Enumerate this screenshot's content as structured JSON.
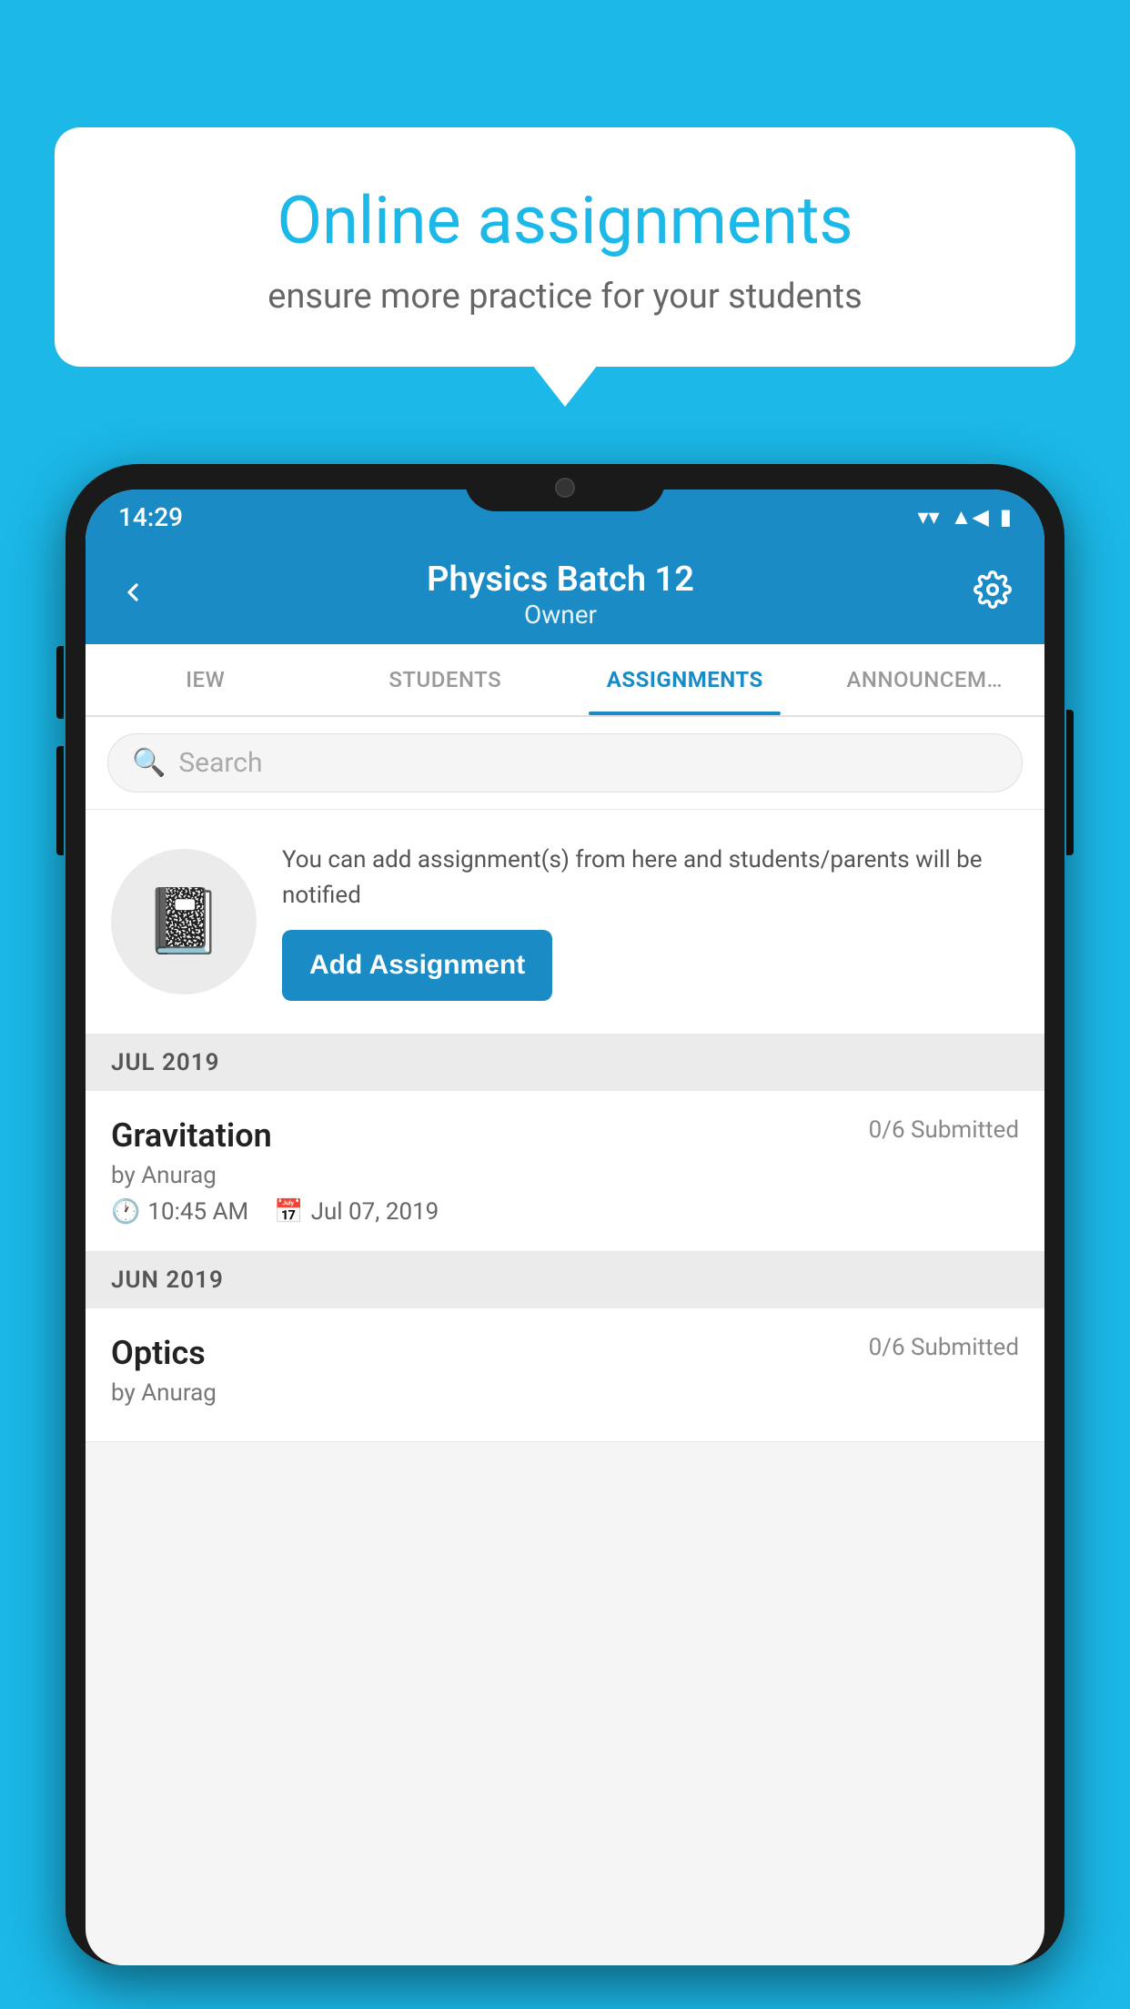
{
  "background_color": "#1bb8e8",
  "speech_bubble": {
    "title": "Online assignments",
    "subtitle": "ensure more practice for your students"
  },
  "phone": {
    "status_bar": {
      "time": "14:29",
      "wifi_icon": "wifi",
      "signal_icon": "signal",
      "battery_icon": "battery"
    },
    "top_bar": {
      "title": "Physics Batch 12",
      "subtitle": "Owner",
      "back_label": "←",
      "settings_label": "⚙"
    },
    "tabs": [
      {
        "label": "IEW",
        "active": false
      },
      {
        "label": "STUDENTS",
        "active": false
      },
      {
        "label": "ASSIGNMENTS",
        "active": true
      },
      {
        "label": "ANNOUNCEM…",
        "active": false
      }
    ],
    "search": {
      "placeholder": "Search"
    },
    "promo": {
      "text": "You can add assignment(s) from here and students/parents will be notified",
      "button_label": "Add Assignment"
    },
    "sections": [
      {
        "header": "JUL 2019",
        "assignments": [
          {
            "name": "Gravitation",
            "status": "0/6 Submitted",
            "by": "by Anurag",
            "time": "10:45 AM",
            "date": "Jul 07, 2019"
          }
        ]
      },
      {
        "header": "JUN 2019",
        "assignments": [
          {
            "name": "Optics",
            "status": "0/6 Submitted",
            "by": "by Anurag",
            "time": "",
            "date": ""
          }
        ]
      }
    ]
  }
}
